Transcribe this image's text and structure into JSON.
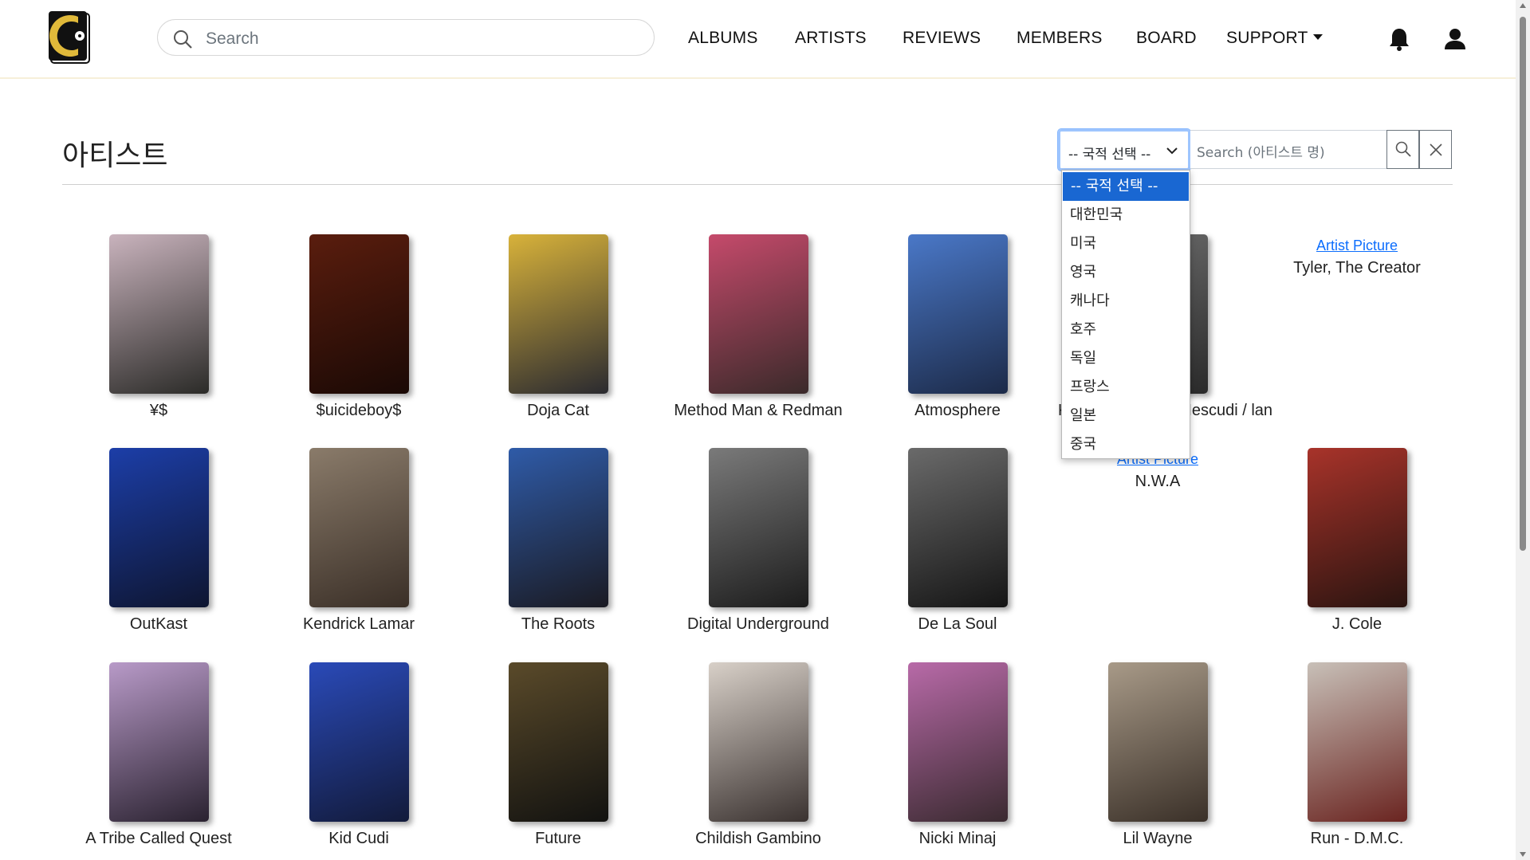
{
  "header": {
    "search_placeholder": "Search",
    "nav": [
      "ALBUMS",
      "ARTISTS",
      "REVIEWS",
      "MEMBERS",
      "BOARD",
      "SUPPORT"
    ]
  },
  "page": {
    "title": "아티스트",
    "nationality_select": "-- 국적 선택 --",
    "search_placeholder": "Search (아티스트 명)"
  },
  "dropdown_options": [
    "-- 국적 선택 --",
    "대한민국",
    "미국",
    "영국",
    "캐나다",
    "호주",
    "독일",
    "프랑스",
    "일본",
    "중국"
  ],
  "broken_image_alt": "Artist Picture",
  "artists": [
    {
      "name": "¥$",
      "colors": [
        "#c9b3bd",
        "#2b2b28"
      ]
    },
    {
      "name": "$uicideboy$",
      "colors": [
        "#5a1d0e",
        "#1a0905"
      ]
    },
    {
      "name": "Doja Cat",
      "colors": [
        "#d8b23a",
        "#2a2a30"
      ]
    },
    {
      "name": "Method Man & Redman",
      "colors": [
        "#c54a6b",
        "#3a2a2a"
      ]
    },
    {
      "name": "Atmosphere",
      "colors": [
        "#4a78c8",
        "#1c2a48"
      ]
    },
    {
      "name": "Kid Cudi & Scott Mescudi / lan",
      "colors": [
        "#6b6b6b",
        "#2a2a2a"
      ]
    },
    {
      "name": "Tyler, The Creator",
      "broken": true
    },
    {
      "name": "OutKast",
      "colors": [
        "#1c3ea8",
        "#0e1530"
      ]
    },
    {
      "name": "Kendrick Lamar",
      "colors": [
        "#8a7b6a",
        "#3a2f27"
      ]
    },
    {
      "name": "The Roots",
      "colors": [
        "#2f5ba8",
        "#1a1a22"
      ]
    },
    {
      "name": "Digital Underground",
      "colors": [
        "#7a7a7a",
        "#1c1c1c"
      ]
    },
    {
      "name": "De La Soul",
      "colors": [
        "#6a6a6a",
        "#151515"
      ]
    },
    {
      "name": "N.W.A",
      "broken": true
    },
    {
      "name": "J. Cole",
      "colors": [
        "#a8332a",
        "#2a1410"
      ]
    },
    {
      "name": "A Tribe Called Quest",
      "colors": [
        "#b89ac8",
        "#2a2230"
      ]
    },
    {
      "name": "Kid Cudi",
      "colors": [
        "#2a4ab8",
        "#121a3a"
      ]
    },
    {
      "name": "Future",
      "colors": [
        "#5a4a2a",
        "#121210"
      ]
    },
    {
      "name": "Childish Gambino",
      "colors": [
        "#d8d0c8",
        "#3a3230"
      ]
    },
    {
      "name": "Nicki Minaj",
      "colors": [
        "#b86aa8",
        "#3a2a30"
      ]
    },
    {
      "name": "Lil Wayne",
      "colors": [
        "#a89a88",
        "#3a3028"
      ]
    },
    {
      "name": "Run - D.M.C.",
      "colors": [
        "#c8c0b8",
        "#6a2420"
      ]
    }
  ]
}
